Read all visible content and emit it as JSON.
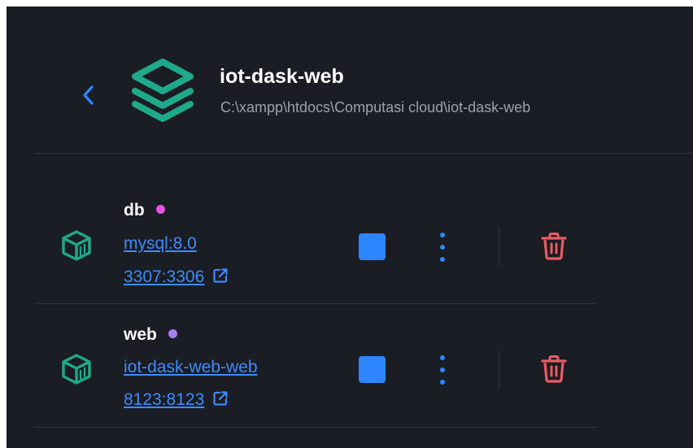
{
  "header": {
    "back_icon": "chevron-left-icon",
    "project_icon": "layers-stack-icon",
    "title": "iot-dask-web",
    "path": "C:\\xampp\\htdocs\\Computasi cloud\\iot-dask-web"
  },
  "containers": [
    {
      "name": "db",
      "status_color": "#e354e3",
      "image": "mysql:8.0",
      "ports": "3307:3306",
      "icon": "container-cube-icon"
    },
    {
      "name": "web",
      "status_color": "#a77ff0",
      "image": "iot-dask-web-web",
      "ports": "8123:8123",
      "icon": "container-cube-icon"
    }
  ],
  "colors": {
    "background": "#1a1d23",
    "accent_green": "#1fa98b",
    "link_blue": "#3d8bff",
    "action_blue": "#2e86ff",
    "delete_red": "#e95b64"
  }
}
